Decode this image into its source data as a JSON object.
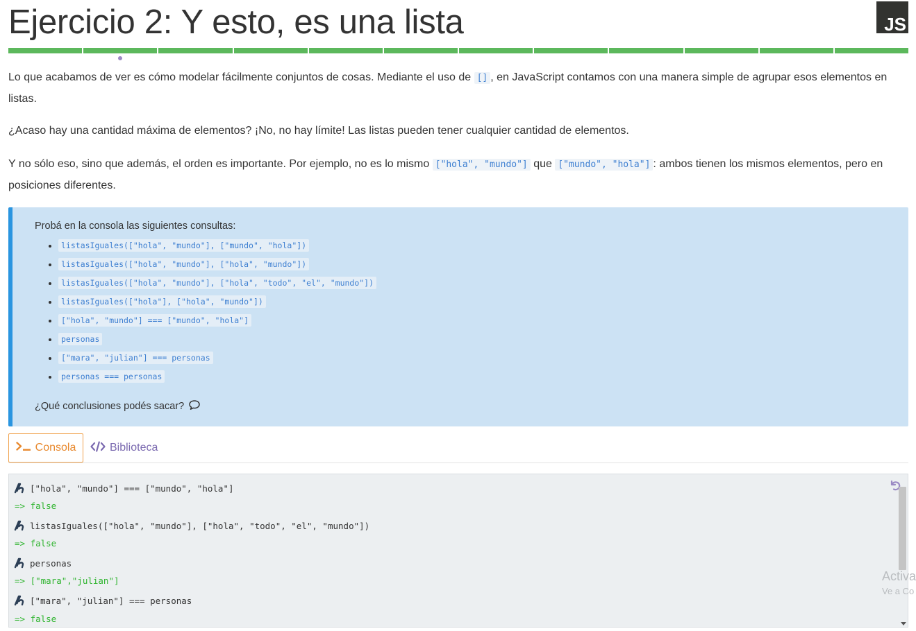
{
  "page": {
    "title": "Ejercicio 2: Y esto, es una lista",
    "badge": "JS"
  },
  "progress": {
    "total_segments": 12,
    "completed_segments": 12,
    "current_index": 2
  },
  "content": {
    "p1_a": "Lo que acabamos de ver es cómo modelar fácilmente conjuntos de cosas. Mediante el uso de ",
    "p1_code": "[]",
    "p1_b": ", en JavaScript contamos con una manera simple de agrupar esos elementos en listas.",
    "p2": "¿Acaso hay una cantidad máxima de elementos? ¡No, no hay límite! Las listas pueden tener cualquier cantidad de elementos.",
    "p3_a": "Y no sólo eso, sino que además, el orden es importante. Por ejemplo, no es lo mismo ",
    "p3_code1": "[\"hola\", \"mundo\"]",
    "p3_b": " que ",
    "p3_code2": "[\"mundo\", \"hola\"]",
    "p3_c": ": ambos tienen los mismos elementos, pero en posiciones diferentes."
  },
  "callout": {
    "lead": "Probá en la consola las siguientes consultas:",
    "items": [
      "listasIguales([\"hola\", \"mundo\"], [\"mundo\", \"hola\"])",
      "listasIguales([\"hola\", \"mundo\"], [\"hola\", \"mundo\"])",
      "listasIguales([\"hola\", \"mundo\"], [\"hola\", \"todo\", \"el\", \"mundo\"])",
      "listasIguales([\"hola\"], [\"hola\", \"mundo\"])",
      "[\"hola\", \"mundo\"] === [\"mundo\", \"hola\"]",
      "personas",
      "[\"mara\", \"julian\"] === personas",
      "personas === personas"
    ],
    "question": "¿Qué conclusiones podés sacar?",
    "question_icon": "speech-bubble-icon"
  },
  "tabs": [
    {
      "label": "Consola",
      "icon": "terminal-icon",
      "active": true
    },
    {
      "label": "Biblioteca",
      "icon": "code-icon",
      "active": false
    }
  ],
  "console": {
    "lines": [
      {
        "kind": "in",
        "text": "[\"hola\", \"mundo\"] === [\"mundo\", \"hola\"]"
      },
      {
        "kind": "out",
        "text": "=> false"
      },
      {
        "kind": "in",
        "text": "listasIguales([\"hola\", \"mundo\"], [\"hola\", \"todo\", \"el\", \"mundo\"])"
      },
      {
        "kind": "out",
        "text": "=> false"
      },
      {
        "kind": "in",
        "text": "personas"
      },
      {
        "kind": "out",
        "text": "=> [\"mara\",\"julian\"]"
      },
      {
        "kind": "in",
        "text": "[\"mara\", \"julian\"] === personas"
      },
      {
        "kind": "out",
        "text": "=> false"
      }
    ],
    "reset_icon": "reset-icon"
  },
  "watermark": {
    "line1": "Activa",
    "line2": "Ve a Co"
  },
  "colors": {
    "progress": "#5cb85c",
    "callout_bg": "#cce2f4",
    "callout_border": "#2a95e0",
    "console_ok": "#2fb42f",
    "tab_active": "#e8892e",
    "tab_library": "#7b6ab0"
  }
}
